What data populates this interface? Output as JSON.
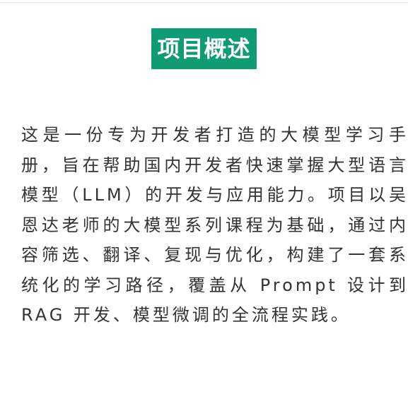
{
  "section": {
    "title": "项目概述",
    "accent_color": "#0f9b73"
  },
  "body": {
    "paragraph": "这是一份专为开发者打造的大模型学习手册，旨在帮助国内开发者快速掌握大型语言模型（LLM）的开发与应用能力。项目以吴恩达老师的大模型系列课程为基础，通过内容筛选、翻译、复现与优化，构建了一套系统化的学习路径，覆盖从 Prompt 设计到 RAG 开发、模型微调的全流程实践。"
  }
}
